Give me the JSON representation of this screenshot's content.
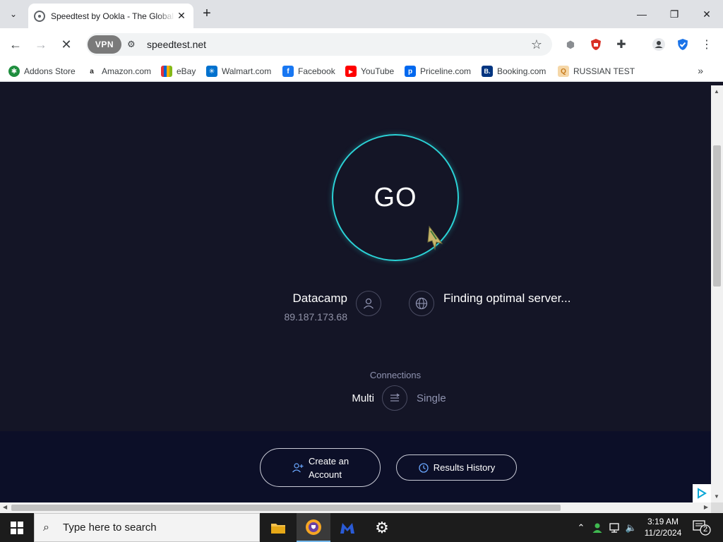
{
  "browser": {
    "tab": {
      "title": "Speedtest by Ookla - The Global Broadband Speed Test",
      "close_glyph": "✕"
    },
    "new_tab_glyph": "+",
    "window_controls": {
      "minimize": "—",
      "restore": "❐",
      "close": "✕"
    },
    "vpn_label": "VPN",
    "url": "speedtest.net"
  },
  "bookmarks": [
    {
      "label": "Addons Store",
      "icon": "addons-store-icon",
      "color": "#1e8e3e",
      "glyph": "✱"
    },
    {
      "label": "Amazon.com",
      "icon": "amazon-icon",
      "color": "#222222",
      "glyph": "a"
    },
    {
      "label": "eBay",
      "icon": "ebay-icon",
      "color": "#e53238",
      "glyph": "▤"
    },
    {
      "label": "Walmart.com",
      "icon": "walmart-icon",
      "color": "#0071ce",
      "glyph": "✳"
    },
    {
      "label": "Facebook",
      "icon": "facebook-icon",
      "color": "#1877f2",
      "glyph": "f"
    },
    {
      "label": "YouTube",
      "icon": "youtube-icon",
      "color": "#ff0000",
      "glyph": "▶"
    },
    {
      "label": "Priceline.com",
      "icon": "priceline-icon",
      "color": "#0068ef",
      "glyph": "p"
    },
    {
      "label": "Booking.com",
      "icon": "booking-icon",
      "color": "#003580",
      "glyph": "B."
    },
    {
      "label": "RUSSIAN TEST",
      "icon": "russian-test-icon",
      "color": "#f5d7a8",
      "glyph": "Q"
    }
  ],
  "speedtest": {
    "go_label": "GO",
    "isp_name": "Datacamp",
    "isp_ip": "89.187.173.68",
    "server_status": "Finding optimal server...",
    "connections_label": "Connections",
    "multi_label": "Multi",
    "single_label": "Single",
    "create_account_line1": "Create an",
    "create_account_line2": "Account",
    "results_history_label": "Results History",
    "accent_color": "#2bd2d6"
  },
  "taskbar": {
    "search_placeholder": "Type here to search",
    "time": "3:19 AM",
    "date": "11/2/2024",
    "notification_count": "2"
  }
}
